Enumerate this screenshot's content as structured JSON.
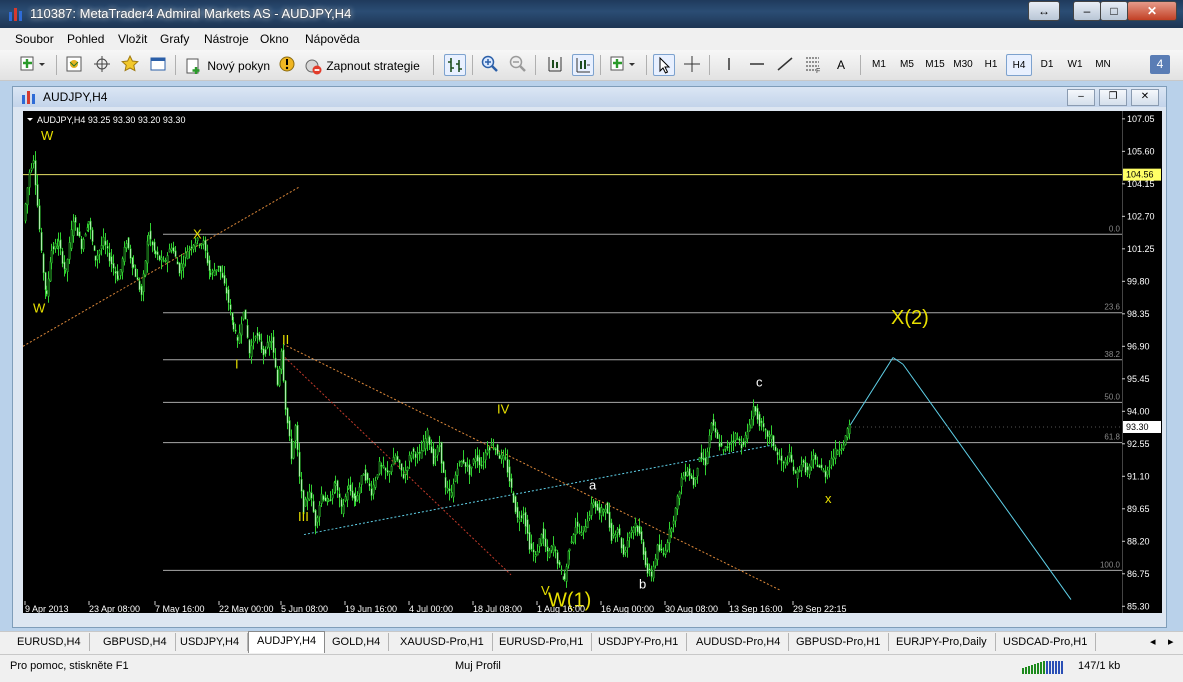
{
  "window": {
    "title": "110387: MetaTrader4 Admiral Markets AS - AUDJPY,H4"
  },
  "menu": [
    "Soubor",
    "Pohled",
    "Vložit",
    "Grafy",
    "Nástroje",
    "Okno",
    "Nápověda"
  ],
  "toolbar": {
    "new_order": "Nový pokyn",
    "auto_trading": "Zapnout strategie",
    "label_tool": "A",
    "timeframes": [
      "M1",
      "M5",
      "M15",
      "M30",
      "H1",
      "H4",
      "D1",
      "W1",
      "MN"
    ],
    "active_timeframe": "H4",
    "counter_badge": "4"
  },
  "chart_window": {
    "title": "AUDJPY,H4"
  },
  "chart_data": {
    "type": "candlestick",
    "header": "AUDJPY,H4  93.25 93.30 93.20 93.30",
    "y_ticks": [
      "107.05",
      "105.60",
      "104.15",
      "102.70",
      "101.25",
      "99.80",
      "98.35",
      "96.90",
      "95.45",
      "94.00",
      "92.55",
      "91.10",
      "89.65",
      "88.20",
      "86.75",
      "85.30"
    ],
    "ylim": [
      85.0,
      107.4
    ],
    "x_ticks": [
      "9 Apr 2013",
      "23 Apr 08:00",
      "7 May 16:00",
      "22 May 00:00",
      "5 Jun 08:00",
      "19 Jun 16:00",
      "4 Jul 00:00",
      "18 Jul 08:00",
      "1 Aug 16:00",
      "16 Aug 00:00",
      "30 Aug 08:00",
      "13 Sep 16:00",
      "29 Sep 22:15"
    ],
    "current_price": "93.30",
    "marked_level": "104.56",
    "fibonacci_levels": [
      {
        "label": "0.0",
        "value": 101.9
      },
      {
        "label": "23.6",
        "value": 98.4
      },
      {
        "label": "38.2",
        "value": 96.3
      },
      {
        "label": "50.0",
        "value": 94.4
      },
      {
        "label": "61.8",
        "value": 92.6
      },
      {
        "label": "100.0",
        "value": 86.9
      }
    ],
    "close_path": [
      {
        "t": 0,
        "v": 102.5
      },
      {
        "t": 6,
        "v": 104.7
      },
      {
        "t": 10,
        "v": 105.3
      },
      {
        "t": 14,
        "v": 103.2
      },
      {
        "t": 18,
        "v": 101.0
      },
      {
        "t": 23,
        "v": 99.1
      },
      {
        "t": 28,
        "v": 101.2
      },
      {
        "t": 35,
        "v": 101.5
      },
      {
        "t": 42,
        "v": 100.2
      },
      {
        "t": 50,
        "v": 102.6
      },
      {
        "t": 58,
        "v": 101.4
      },
      {
        "t": 65,
        "v": 102.5
      },
      {
        "t": 72,
        "v": 100.8
      },
      {
        "t": 80,
        "v": 101.6
      },
      {
        "t": 88,
        "v": 100.6
      },
      {
        "t": 95,
        "v": 99.9
      },
      {
        "t": 103,
        "v": 101.6
      },
      {
        "t": 110,
        "v": 100.4
      },
      {
        "t": 118,
        "v": 99.2
      },
      {
        "t": 125,
        "v": 101.9
      },
      {
        "t": 132,
        "v": 101.0
      },
      {
        "t": 140,
        "v": 100.6
      },
      {
        "t": 148,
        "v": 101.4
      },
      {
        "t": 156,
        "v": 100.3
      },
      {
        "t": 164,
        "v": 101.2
      },
      {
        "t": 172,
        "v": 101.6
      },
      {
        "t": 180,
        "v": 101.5
      },
      {
        "t": 187,
        "v": 100.1
      },
      {
        "t": 195,
        "v": 100.5
      },
      {
        "t": 203,
        "v": 99.3
      },
      {
        "t": 210,
        "v": 97.8
      },
      {
        "t": 214,
        "v": 97.0
      },
      {
        "t": 220,
        "v": 98.6
      },
      {
        "t": 226,
        "v": 96.6
      },
      {
        "t": 232,
        "v": 97.5
      },
      {
        "t": 240,
        "v": 96.6
      },
      {
        "t": 248,
        "v": 97.2
      },
      {
        "t": 254,
        "v": 95.2
      },
      {
        "t": 258,
        "v": 96.8
      },
      {
        "t": 262,
        "v": 94.2
      },
      {
        "t": 268,
        "v": 92.0
      },
      {
        "t": 272,
        "v": 93.3
      },
      {
        "t": 276,
        "v": 91.0
      },
      {
        "t": 280,
        "v": 89.6
      },
      {
        "t": 286,
        "v": 90.5
      },
      {
        "t": 292,
        "v": 89.0
      },
      {
        "t": 298,
        "v": 90.3
      },
      {
        "t": 305,
        "v": 89.9
      },
      {
        "t": 312,
        "v": 90.8
      },
      {
        "t": 318,
        "v": 89.6
      },
      {
        "t": 325,
        "v": 90.6
      },
      {
        "t": 332,
        "v": 90.0
      },
      {
        "t": 340,
        "v": 91.3
      },
      {
        "t": 348,
        "v": 90.4
      },
      {
        "t": 356,
        "v": 91.6
      },
      {
        "t": 364,
        "v": 91.2
      },
      {
        "t": 372,
        "v": 92.0
      },
      {
        "t": 380,
        "v": 91.1
      },
      {
        "t": 388,
        "v": 92.2
      },
      {
        "t": 396,
        "v": 92.0
      },
      {
        "t": 404,
        "v": 93.0
      },
      {
        "t": 410,
        "v": 91.8
      },
      {
        "t": 416,
        "v": 92.5
      },
      {
        "t": 422,
        "v": 90.5
      },
      {
        "t": 428,
        "v": 90.3
      },
      {
        "t": 434,
        "v": 91.6
      },
      {
        "t": 440,
        "v": 91.8
      },
      {
        "t": 446,
        "v": 91.3
      },
      {
        "t": 452,
        "v": 92.0
      },
      {
        "t": 458,
        "v": 91.6
      },
      {
        "t": 464,
        "v": 92.4
      },
      {
        "t": 470,
        "v": 92.5
      },
      {
        "t": 476,
        "v": 92.0
      },
      {
        "t": 482,
        "v": 91.8
      },
      {
        "t": 488,
        "v": 90.5
      },
      {
        "t": 494,
        "v": 89.2
      },
      {
        "t": 500,
        "v": 89.5
      },
      {
        "t": 506,
        "v": 88.0
      },
      {
        "t": 512,
        "v": 87.5
      },
      {
        "t": 518,
        "v": 88.6
      },
      {
        "t": 524,
        "v": 87.6
      },
      {
        "t": 530,
        "v": 88.0
      },
      {
        "t": 536,
        "v": 87.0
      },
      {
        "t": 541,
        "v": 86.5
      },
      {
        "t": 546,
        "v": 88.0
      },
      {
        "t": 552,
        "v": 88.9
      },
      {
        "t": 558,
        "v": 88.5
      },
      {
        "t": 564,
        "v": 89.2
      },
      {
        "t": 570,
        "v": 90.0
      },
      {
        "t": 576,
        "v": 89.4
      },
      {
        "t": 582,
        "v": 89.8
      },
      {
        "t": 588,
        "v": 88.4
      },
      {
        "t": 594,
        "v": 88.8
      },
      {
        "t": 600,
        "v": 87.6
      },
      {
        "t": 606,
        "v": 88.6
      },
      {
        "t": 612,
        "v": 89.0
      },
      {
        "t": 618,
        "v": 88.2
      },
      {
        "t": 624,
        "v": 86.8
      },
      {
        "t": 628,
        "v": 86.7
      },
      {
        "t": 634,
        "v": 87.9
      },
      {
        "t": 640,
        "v": 87.6
      },
      {
        "t": 646,
        "v": 88.6
      },
      {
        "t": 652,
        "v": 89.6
      },
      {
        "t": 658,
        "v": 91.0
      },
      {
        "t": 664,
        "v": 91.4
      },
      {
        "t": 670,
        "v": 90.8
      },
      {
        "t": 676,
        "v": 92.0
      },
      {
        "t": 682,
        "v": 91.7
      },
      {
        "t": 688,
        "v": 93.5
      },
      {
        "t": 694,
        "v": 92.7
      },
      {
        "t": 700,
        "v": 92.2
      },
      {
        "t": 706,
        "v": 92.6
      },
      {
        "t": 712,
        "v": 92.9
      },
      {
        "t": 718,
        "v": 92.5
      },
      {
        "t": 724,
        "v": 93.0
      },
      {
        "t": 730,
        "v": 94.2
      },
      {
        "t": 736,
        "v": 93.5
      },
      {
        "t": 742,
        "v": 93.0
      },
      {
        "t": 748,
        "v": 92.8
      },
      {
        "t": 754,
        "v": 92.0
      },
      {
        "t": 760,
        "v": 91.6
      },
      {
        "t": 766,
        "v": 92.0
      },
      {
        "t": 772,
        "v": 91.1
      },
      {
        "t": 778,
        "v": 91.7
      },
      {
        "t": 784,
        "v": 91.3
      },
      {
        "t": 790,
        "v": 91.9
      },
      {
        "t": 796,
        "v": 91.5
      },
      {
        "t": 802,
        "v": 91.2
      },
      {
        "t": 808,
        "v": 91.9
      },
      {
        "t": 814,
        "v": 92.3
      },
      {
        "t": 820,
        "v": 92.6
      },
      {
        "t": 826,
        "v": 93.3
      }
    ],
    "elliott_labels": [
      {
        "text": "W",
        "t": 18,
        "v": 106.1,
        "color": "#e8e000",
        "size": 13
      },
      {
        "text": "W",
        "t": 10,
        "v": 98.4,
        "color": "#e8e000",
        "size": 13
      },
      {
        "text": "X",
        "t": 170,
        "v": 101.7,
        "color": "#e8e000",
        "size": 13
      },
      {
        "text": "I",
        "t": 212,
        "v": 95.9,
        "color": "#e8e000",
        "size": 13
      },
      {
        "text": "II",
        "t": 259,
        "v": 97.0,
        "color": "#e8e000",
        "size": 13
      },
      {
        "text": "III",
        "t": 275,
        "v": 89.1,
        "color": "#e8e000",
        "size": 13
      },
      {
        "text": "IV",
        "t": 474,
        "v": 93.9,
        "color": "#e8e000",
        "size": 13
      },
      {
        "text": "V",
        "t": 518,
        "v": 85.8,
        "color": "#e8e000",
        "size": 13
      },
      {
        "text": "W(1)",
        "t": 525,
        "v": 85.3,
        "color": "#e8e000",
        "size": 20
      },
      {
        "text": "a",
        "t": 566,
        "v": 90.5,
        "color": "#ffffff",
        "size": 13
      },
      {
        "text": "b",
        "t": 616,
        "v": 86.1,
        "color": "#ffffff",
        "size": 13
      },
      {
        "text": "c",
        "t": 733,
        "v": 95.1,
        "color": "#ffffff",
        "size": 13
      },
      {
        "text": "x",
        "t": 802,
        "v": 89.9,
        "color": "#e8e000",
        "size": 13
      },
      {
        "text": "X(2)",
        "t": 868,
        "v": 97.9,
        "color": "#e8e000",
        "size": 20
      }
    ],
    "trendlines": [
      {
        "style": "orange-dotted",
        "from": {
          "t": 0,
          "v": 96.9
        },
        "to": {
          "t": 276,
          "v": 104.0
        }
      },
      {
        "style": "orange-dotted",
        "from": {
          "t": 260,
          "v": 97.0
        },
        "to": {
          "t": 758,
          "v": 86.0
        }
      },
      {
        "style": "red-dotted",
        "from": {
          "t": 262,
          "v": 96.4
        },
        "to": {
          "t": 488,
          "v": 86.7
        }
      },
      {
        "style": "cyan-dotted",
        "from": {
          "t": 281,
          "v": 88.5
        },
        "to": {
          "t": 750,
          "v": 92.5
        }
      },
      {
        "style": "cyan-solid",
        "from": {
          "t": 826,
          "v": 93.3
        },
        "to": {
          "t": 870,
          "v": 96.4
        }
      },
      {
        "style": "cyan-solid",
        "from": {
          "t": 870,
          "v": 96.4
        },
        "to": {
          "t": 880,
          "v": 96.1
        }
      },
      {
        "style": "cyan-solid",
        "from": {
          "t": 880,
          "v": 96.1
        },
        "to": {
          "t": 1048,
          "v": 85.6
        }
      }
    ]
  },
  "tabs": [
    "EURUSD,H4",
    "GBPUSD,H4",
    "USDJPY,H4",
    "AUDJPY,H4",
    "GOLD,H4",
    "XAUUSD-Pro,H1",
    "EURUSD-Pro,H1",
    "USDJPY-Pro,H1",
    "AUDUSD-Pro,H4",
    "GBPUSD-Pro,H1",
    "EURJPY-Pro,Daily",
    "USDCAD-Pro,H1"
  ],
  "active_tab": "AUDJPY,H4",
  "status": {
    "help": "Pro pomoc, stiskněte F1",
    "profile": "Muj Profil",
    "traffic": "147/1 kb"
  }
}
